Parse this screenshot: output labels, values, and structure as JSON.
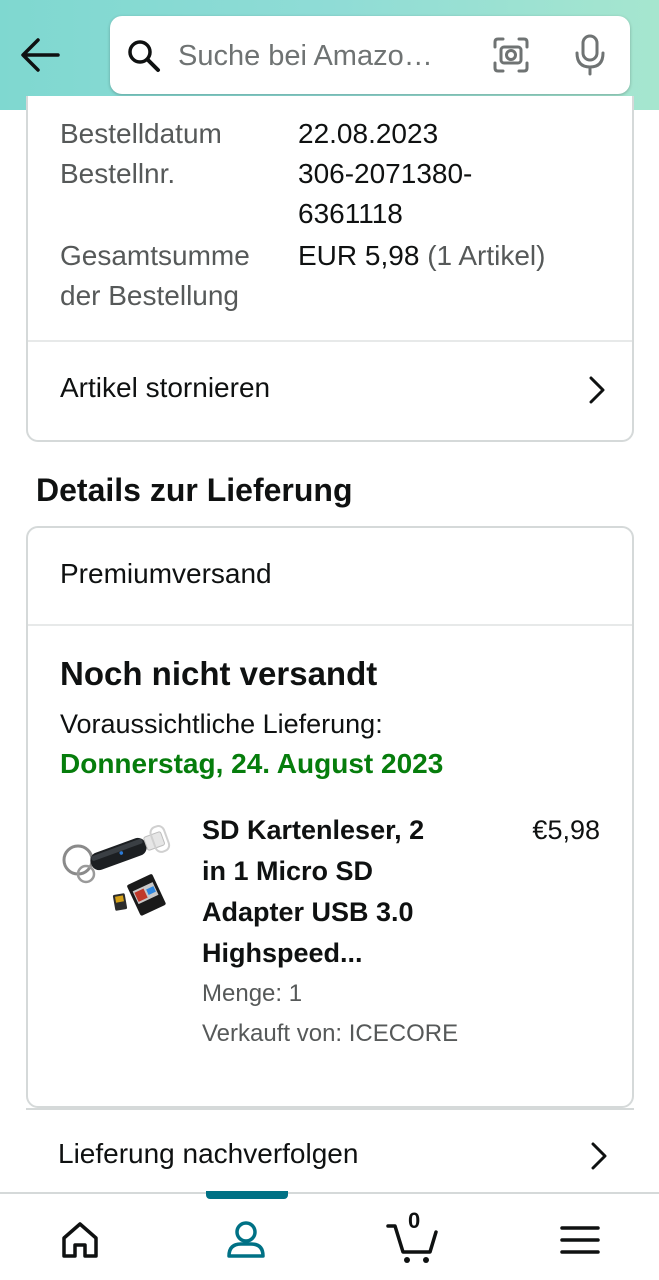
{
  "header": {
    "back_label": "back",
    "search": {
      "placeholder": "Suche bei Amazo…"
    },
    "colors": {
      "gradient_start": "#7fd8d0",
      "gradient_end": "#a6e6cf"
    }
  },
  "order_info": {
    "rows": [
      {
        "label": "Bestelldatum",
        "value": "22.08.2023"
      },
      {
        "label": "Bestellnr.",
        "value_line1": "306-2071380-",
        "value_line2": "6361118"
      },
      {
        "label_line1": "Gesamtsumme",
        "label_line2": "der Bestellung",
        "value": "EUR 5,98",
        "value_extra": "(1 Artikel)"
      }
    ],
    "cancel_label": "Artikel stornieren"
  },
  "delivery": {
    "section_title": "Details zur Lieferung",
    "shipping_type": "Premiumversand",
    "status": "Noch nicht versandt",
    "eta_label": "Voraussichtliche Lieferung:",
    "eta_date": "Donnerstag, 24. August 2023",
    "eta_color": "#067d0c",
    "item": {
      "title_lines": [
        "SD Kartenleser, 2",
        "in 1 Micro SD",
        "Adapter USB 3.0",
        "Highspeed..."
      ],
      "price": "€5,98",
      "quantity": "Menge: 1",
      "seller": "Verkauft von: ICECORE"
    },
    "track_label": "Lieferung nachverfolgen"
  },
  "bottom_nav": {
    "items": [
      {
        "icon": "home-icon"
      },
      {
        "icon": "user-icon",
        "active": true
      },
      {
        "icon": "cart-icon",
        "count": "0"
      },
      {
        "icon": "menu-icon"
      }
    ],
    "active_color": "#007185"
  }
}
